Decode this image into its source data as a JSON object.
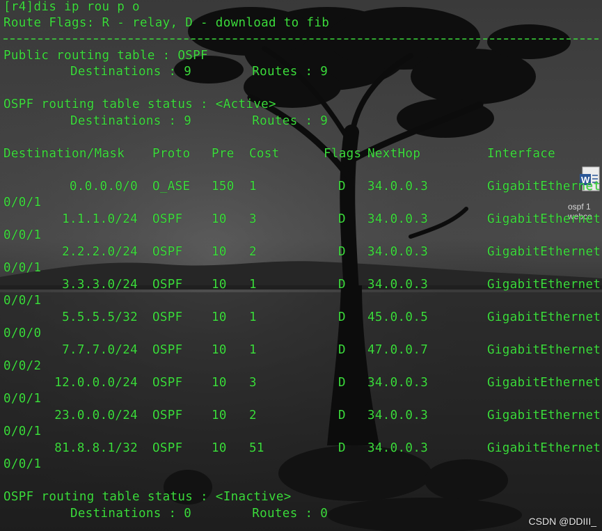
{
  "terminal": {
    "prompt_line": "[r4]dis ip rou p o",
    "flags_line": "Route Flags: R - relay, D - download to fib",
    "public_header": "Public routing table : OSPF",
    "public_counts": "Destinations : 9        Routes : 9",
    "active_header": "OSPF routing table status : <Active>",
    "active_counts": "Destinations : 9        Routes : 9",
    "columns": {
      "destination": "Destination/Mask",
      "proto": "Proto",
      "pre": "Pre",
      "cost": "Cost",
      "flags": "Flags",
      "nexthop": "NextHop",
      "interface": "Interface"
    },
    "routes": [
      {
        "dest": "0.0.0.0/0",
        "proto": "O_ASE",
        "pre": "150",
        "cost": "1",
        "flag": "D",
        "nexthop": "34.0.0.3",
        "iface": "GigabitEthernet",
        "port": "0/0/1"
      },
      {
        "dest": "1.1.1.0/24",
        "proto": "OSPF",
        "pre": "10",
        "cost": "3",
        "flag": "D",
        "nexthop": "34.0.0.3",
        "iface": "GigabitEthernet",
        "port": "0/0/1"
      },
      {
        "dest": "2.2.2.0/24",
        "proto": "OSPF",
        "pre": "10",
        "cost": "2",
        "flag": "D",
        "nexthop": "34.0.0.3",
        "iface": "GigabitEthernet",
        "port": "0/0/1"
      },
      {
        "dest": "3.3.3.0/24",
        "proto": "OSPF",
        "pre": "10",
        "cost": "1",
        "flag": "D",
        "nexthop": "34.0.0.3",
        "iface": "GigabitEthernet",
        "port": "0/0/1"
      },
      {
        "dest": "5.5.5.5/32",
        "proto": "OSPF",
        "pre": "10",
        "cost": "1",
        "flag": "D",
        "nexthop": "45.0.0.5",
        "iface": "GigabitEthernet",
        "port": "0/0/0"
      },
      {
        "dest": "7.7.7.0/24",
        "proto": "OSPF",
        "pre": "10",
        "cost": "1",
        "flag": "D",
        "nexthop": "47.0.0.7",
        "iface": "GigabitEthernet",
        "port": "0/0/2"
      },
      {
        "dest": "12.0.0.0/24",
        "proto": "OSPF",
        "pre": "10",
        "cost": "3",
        "flag": "D",
        "nexthop": "34.0.0.3",
        "iface": "GigabitEthernet",
        "port": "0/0/1"
      },
      {
        "dest": "23.0.0.0/24",
        "proto": "OSPF",
        "pre": "10",
        "cost": "2",
        "flag": "D",
        "nexthop": "34.0.0.3",
        "iface": "GigabitEthernet",
        "port": "0/0/1"
      },
      {
        "dest": "81.8.8.1/32",
        "proto": "OSPF",
        "pre": "10",
        "cost": "51",
        "flag": "D",
        "nexthop": "34.0.0.3",
        "iface": "GigabitEthernet",
        "port": "0/0/1"
      }
    ],
    "inactive_header": "OSPF routing table status : <Inactive>",
    "inactive_counts": "Destinations : 0        Routes : 0"
  },
  "desktop_icon": {
    "icon": "word-document-icon",
    "label": "ospf 1\nwebco"
  },
  "watermark": "CSDN @DDIII_",
  "colors": {
    "terminal_text": "#3cdc3c",
    "background": "#2f2f2f"
  }
}
